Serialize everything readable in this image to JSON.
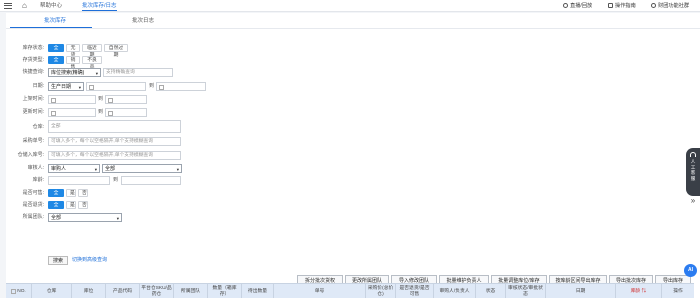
{
  "topbar": {
    "tabs": [
      "帮助中心",
      "批次库存/日志"
    ],
    "right": [
      "直播/回放",
      "操作指南",
      "财团功能社群"
    ]
  },
  "subtabs": [
    "批次库存",
    "批次日志"
  ],
  "filters": {
    "stock_status": {
      "label": "库存状态:",
      "options": [
        "全部",
        "无货",
        "临近期",
        "自然过期"
      ],
      "selected": "全部"
    },
    "stock_type": {
      "label": "存货类型:",
      "options": [
        "全部",
        "销售",
        "不良品"
      ],
      "selected": "全部"
    },
    "quick_query": {
      "label": "快捷查询:",
      "select_value": "库位搜索(精确)",
      "placeholder": "支持精确查询"
    },
    "date": {
      "label": "日期:",
      "select_value": "生产日期",
      "to": "到"
    },
    "shelf_time": {
      "label": "上架时间:",
      "to": "到"
    },
    "update_time": {
      "label": "更新时间:",
      "to": "到"
    },
    "warehouse": {
      "label": "仓库:",
      "placeholder": "全部"
    },
    "purchase_no": {
      "label": "采购单号:",
      "placeholder": "可填入多个，每个以空格隔开,单个支持模糊查询"
    },
    "stockin_no": {
      "label": "仓储入库号:",
      "placeholder": "可填入多个，每个以空格隔开,单个支持模糊查询"
    },
    "auditor": {
      "label": "审核人:",
      "select1": "审购人",
      "select2": "全部"
    },
    "stock_qty": {
      "label": "库龄:",
      "to": "到"
    },
    "sync_warehouse": {
      "label": "是否可售:",
      "options": [
        "全部",
        "是",
        "否"
      ],
      "selected": "全部"
    },
    "returned": {
      "label": "是否退货:",
      "options": [
        "全部",
        "是",
        "否"
      ],
      "selected": "全部"
    },
    "team": {
      "label": "所属团队:",
      "select_value": "全部"
    }
  },
  "search_button": "搜索",
  "toggle_link": "切换到高级查询",
  "actions": [
    "拆分批次货权",
    "更改所属团队",
    "导入修改团队",
    "批量维护负责人",
    "批量调整库位/库存",
    "按库龄区间导出库存",
    "导出批次库存",
    "导出库存"
  ],
  "table_headers": [
    "NO.",
    "仓库",
    "库位",
    "产品代码",
    "平台仓SKU/品\n药仓",
    "所属团队",
    "数量（箱库\n存）",
    "待出数量",
    "单号",
    "采购价(总价\n仓)",
    "是否退货/是否\n可售",
    "审购人/负责人",
    "状态",
    "审核状态/审批状\n态",
    "日期",
    "库龄",
    "操作"
  ],
  "table_header_red": "库龄 ⇅",
  "float_help": "人工客服",
  "ai_badge": "AI",
  "colors": {
    "accent": "#1e88e5",
    "header_bg": "#dfe9f7",
    "red": "#d02b2b"
  }
}
